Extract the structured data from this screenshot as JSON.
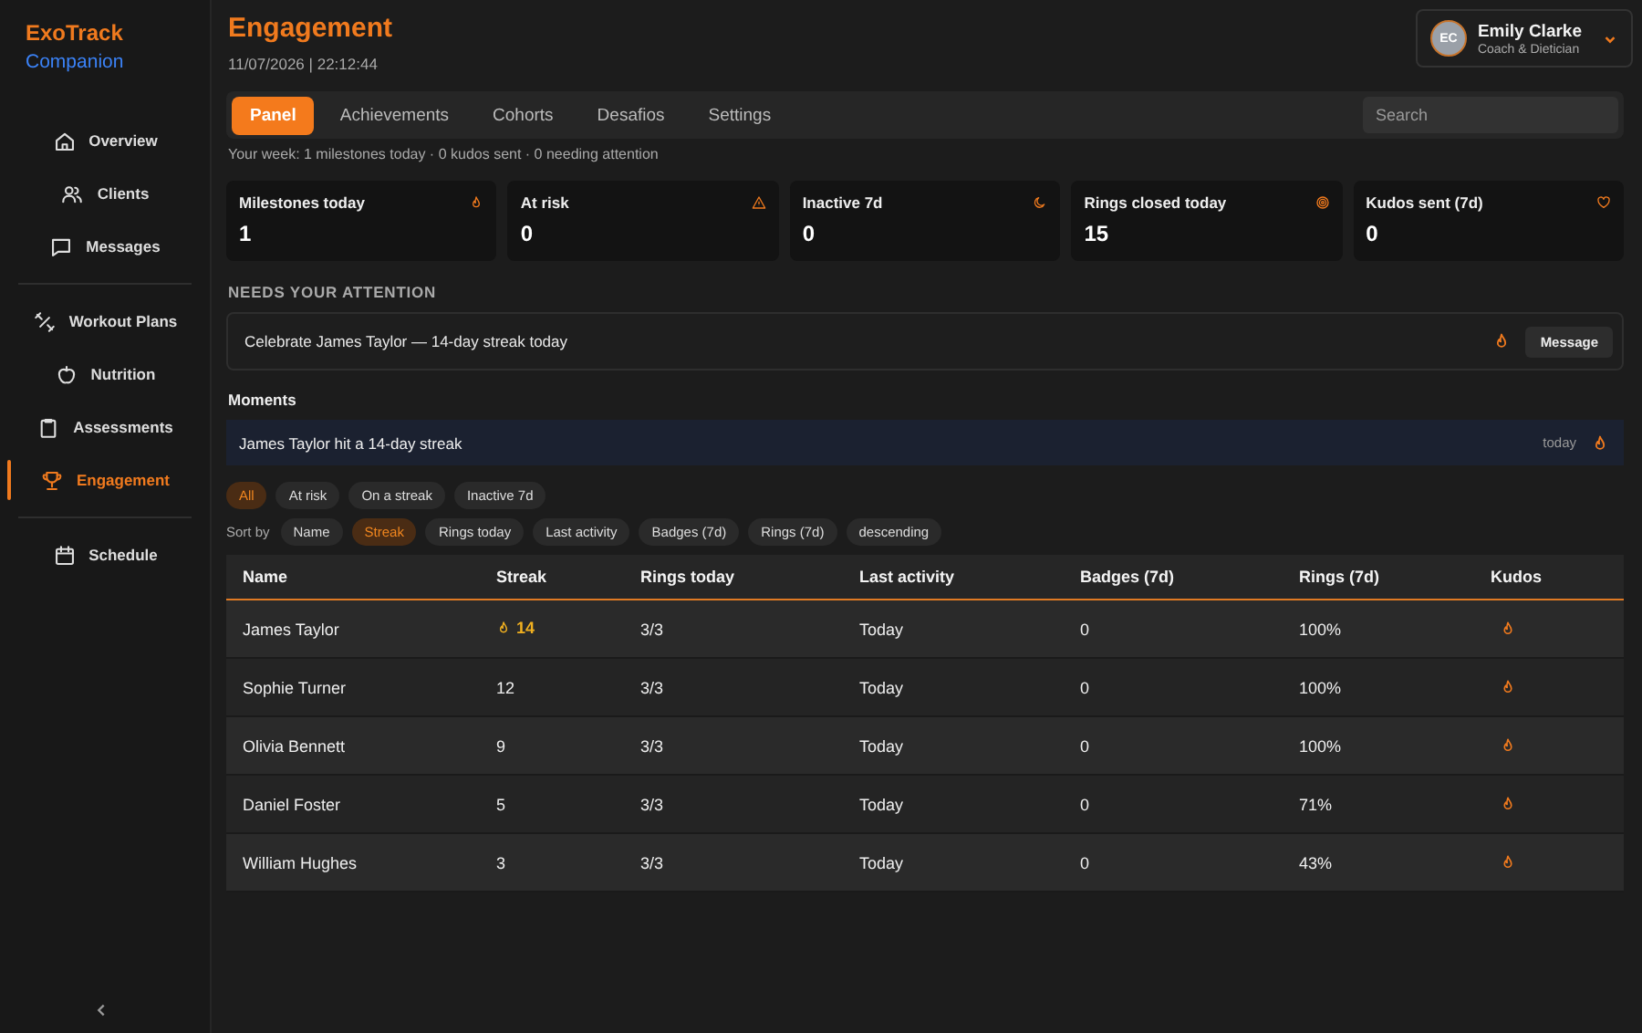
{
  "brand": {
    "name": "ExoTrack",
    "sub": "Companion"
  },
  "sidebar": {
    "groups": [
      [
        {
          "label": "Overview",
          "selected": false
        },
        {
          "label": "Clients",
          "selected": false
        },
        {
          "label": "Messages",
          "selected": false
        }
      ],
      [
        {
          "label": "Workout Plans",
          "selected": false
        },
        {
          "label": "Nutrition",
          "selected": false
        },
        {
          "label": "Assessments",
          "selected": false
        },
        {
          "label": "Engagement",
          "selected": true
        }
      ],
      [
        {
          "label": "Schedule",
          "selected": false
        }
      ]
    ]
  },
  "header": {
    "title": "Engagement",
    "datetime": "11/07/2026 | 22:12:44"
  },
  "user": {
    "initials": "EC",
    "name": "Emily Clarke",
    "role": "Coach & Dietician"
  },
  "tabs": [
    {
      "label": "Panel",
      "selected": true
    },
    {
      "label": "Achievements",
      "selected": false
    },
    {
      "label": "Cohorts",
      "selected": false
    },
    {
      "label": "Desafios",
      "selected": false
    },
    {
      "label": "Settings",
      "selected": false
    }
  ],
  "search": {
    "placeholder": "Search"
  },
  "summary": "Your week: 1 milestones today · 0 kudos sent · 0 needing attention",
  "stats": [
    {
      "label": "Milestones today",
      "value": "1"
    },
    {
      "label": "At risk",
      "value": "0"
    },
    {
      "label": "Inactive 7d",
      "value": "0"
    },
    {
      "label": "Rings closed today",
      "value": "15"
    },
    {
      "label": "Kudos sent (7d)",
      "value": "0"
    }
  ],
  "attention": {
    "heading": "NEEDS YOUR ATTENTION",
    "items": [
      {
        "text": "Celebrate James Taylor — 14-day streak today",
        "button": "Message"
      }
    ]
  },
  "moments": {
    "heading": "Moments",
    "items": [
      {
        "text": "James Taylor hit a 14-day streak",
        "time": "today"
      }
    ]
  },
  "filters": [
    {
      "label": "All",
      "selected": true
    },
    {
      "label": "At risk",
      "selected": false
    },
    {
      "label": "On a streak",
      "selected": false
    },
    {
      "label": "Inactive 7d",
      "selected": false
    }
  ],
  "sort": {
    "label": "Sort by",
    "options": [
      {
        "label": "Name",
        "selected": false
      },
      {
        "label": "Streak",
        "selected": true
      },
      {
        "label": "Rings today",
        "selected": false
      },
      {
        "label": "Last activity",
        "selected": false
      },
      {
        "label": "Badges (7d)",
        "selected": false
      },
      {
        "label": "Rings (7d)",
        "selected": false
      },
      {
        "label": "descending",
        "selected": false
      }
    ]
  },
  "table": {
    "columns": [
      "Name",
      "Streak",
      "Rings today",
      "Last activity",
      "Badges (7d)",
      "Rings (7d)",
      "Kudos"
    ],
    "rows": [
      {
        "name": "James Taylor",
        "streak": "14",
        "hot": true,
        "rings_today": "3/3",
        "last_activity": "Today",
        "badges": "0",
        "rings_7d": "100%"
      },
      {
        "name": "Sophie Turner",
        "streak": "12",
        "hot": false,
        "rings_today": "3/3",
        "last_activity": "Today",
        "badges": "0",
        "rings_7d": "100%"
      },
      {
        "name": "Olivia Bennett",
        "streak": "9",
        "hot": false,
        "rings_today": "3/3",
        "last_activity": "Today",
        "badges": "0",
        "rings_7d": "100%"
      },
      {
        "name": "Daniel Foster",
        "streak": "5",
        "hot": false,
        "rings_today": "3/3",
        "last_activity": "Today",
        "badges": "0",
        "rings_7d": "71%"
      },
      {
        "name": "William Hughes",
        "streak": "3",
        "hot": false,
        "rings_today": "3/3",
        "last_activity": "Today",
        "badges": "0",
        "rings_7d": "43%"
      }
    ]
  }
}
